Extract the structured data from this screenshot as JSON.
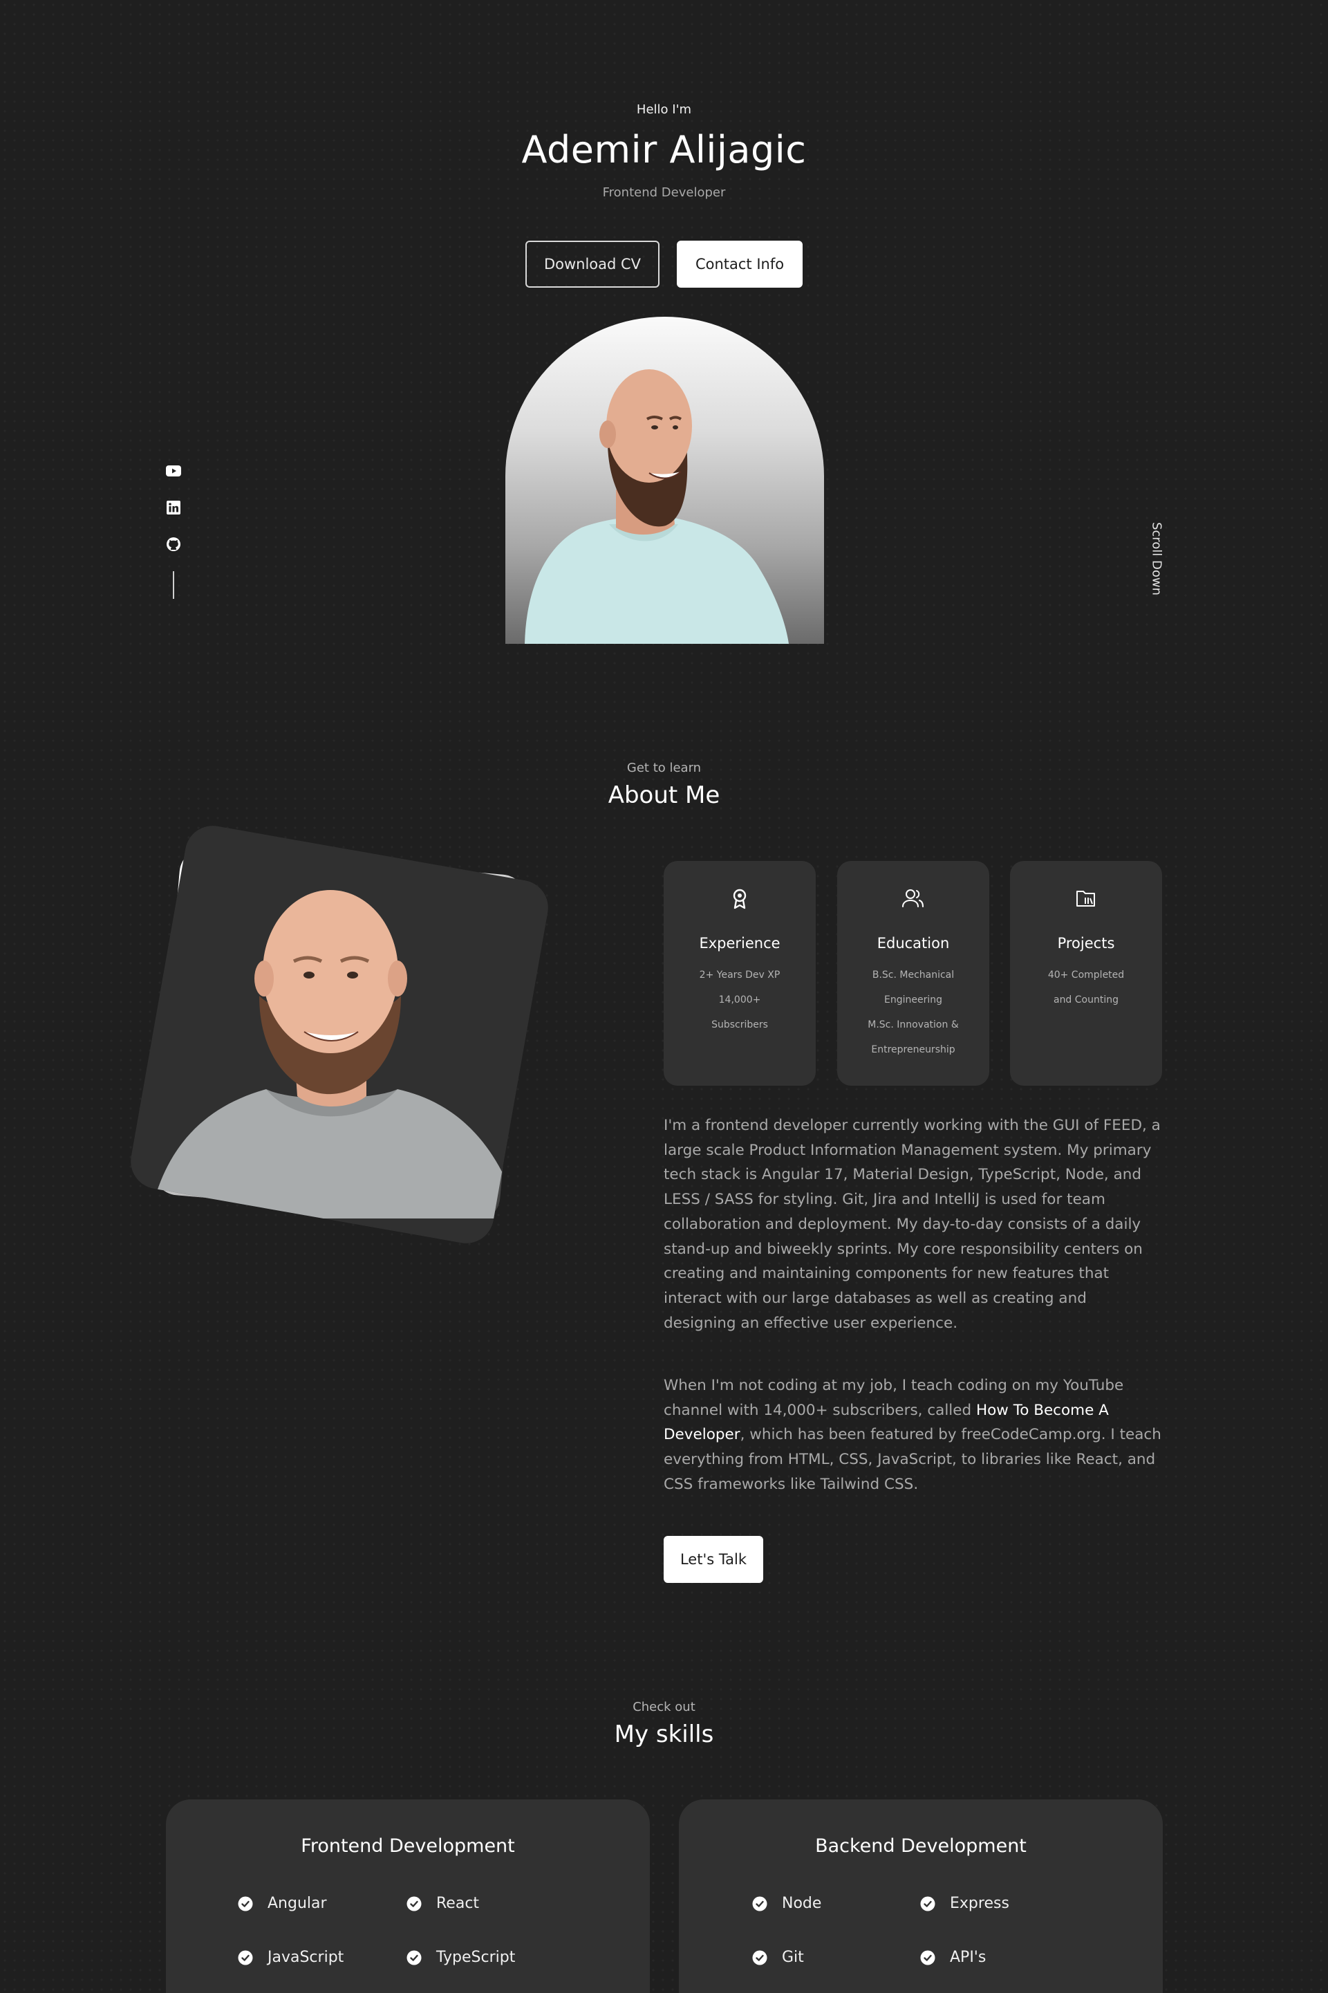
{
  "hero": {
    "greeting": "Hello I'm",
    "name": "Ademir Alijagic",
    "role": "Frontend Developer",
    "download_cv": "Download CV",
    "contact_info": "Contact Info",
    "scroll_down": "Scroll Down"
  },
  "social": {
    "icons": [
      "youtube-icon",
      "linkedin-icon",
      "github-icon"
    ]
  },
  "about": {
    "subtitle": "Get to learn",
    "title": "About Me",
    "cards": [
      {
        "icon": "award-icon",
        "title": "Experience",
        "lines": [
          "2+ Years Dev XP",
          "14,000+",
          "Subscribers"
        ]
      },
      {
        "icon": "users-icon",
        "title": "Education",
        "lines": [
          "B.Sc. Mechanical",
          "Engineering",
          "M.Sc. Innovation &",
          "Entrepreneurship"
        ]
      },
      {
        "icon": "folder-icon",
        "title": "Projects",
        "lines": [
          "40+ Completed",
          "and Counting"
        ]
      }
    ],
    "paragraph1": "I'm a frontend developer currently working with the GUI of FEED, a large scale Product Information Management system. My primary tech stack is Angular 17, Material Design, TypeScript, Node, and LESS / SASS for styling. Git, Jira and IntelliJ is used for team collaboration and deployment. My day-to-day consists of a daily stand-up and biweekly sprints. My core responsibility centers on creating and maintaining components for new features that interact with our large databases as well as creating and designing an effective user experience.",
    "paragraph2_before": "When I'm not coding at my job, I teach coding on my YouTube channel with 14,000+ subscribers, called ",
    "paragraph2_link": "How To Become A Developer",
    "paragraph2_after": ", which has been featured by freeCodeCamp.org. I teach everything from HTML, CSS, JavaScript, to libraries like React, and CSS frameworks like Tailwind CSS.",
    "talk_button": "Let's Talk"
  },
  "skills": {
    "subtitle": "Check out",
    "title": "My skills",
    "frontend": {
      "title": "Frontend Development",
      "items": [
        "Angular",
        "React",
        "JavaScript",
        "TypeScript"
      ]
    },
    "backend": {
      "title": "Backend Development",
      "items": [
        "Node",
        "Express",
        "Git",
        "API's"
      ]
    }
  },
  "colors": {
    "background": "#1f1f1f",
    "card": "#313131",
    "text_primary": "#ffffff",
    "text_muted": "#a9a9a9"
  }
}
